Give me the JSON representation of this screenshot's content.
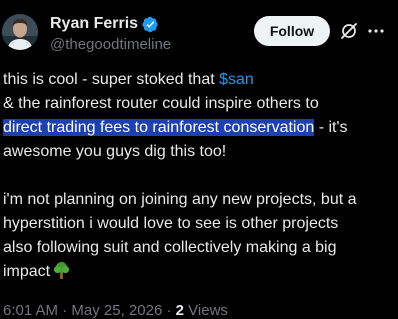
{
  "author": {
    "display_name": "Ryan Ferris",
    "handle": "@thegoodtimeline",
    "verified": true
  },
  "actions": {
    "follow_label": "Follow",
    "grok_icon": "grok-icon",
    "more_icon": "more-horizontal-icon"
  },
  "tweet": {
    "line1_prefix": "this is cool - super stoked that ",
    "line1_cashtag": "$san",
    "line2": "& the rainforest router could inspire others to",
    "line3_highlight": "direct trading fees to rainforest conservation",
    "line3_suffix": " - it's",
    "line4": "awesome you guys dig this too!",
    "line5": "i'm not planning on joining any new projects, but a",
    "line6": "hyperstition i would love to see is other projects",
    "line7": "also following suit and collectively making a big",
    "line8": "impact",
    "emoji": "deciduous-tree-emoji"
  },
  "meta": {
    "time": "6:01 AM",
    "separator": "·",
    "date": "May 25, 2026",
    "views_count": "2",
    "views_label": "Views"
  },
  "colors": {
    "background": "#000000",
    "text": "#e7e9ea",
    "secondary": "#71767b",
    "accent": "#1d9bf0",
    "selection": "#1e3fb0",
    "follow_bg": "#eff3f4"
  }
}
